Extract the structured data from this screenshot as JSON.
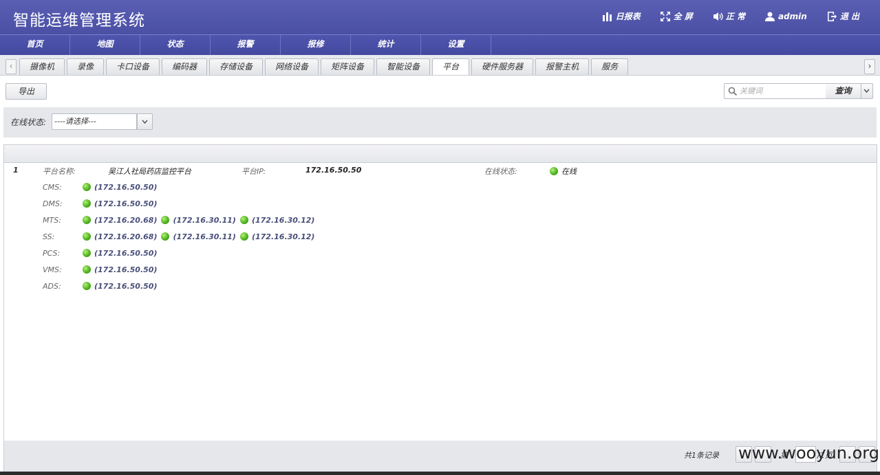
{
  "header": {
    "title": "智能运维管理系统",
    "tools": [
      {
        "icon": "bar-chart-icon",
        "label": "日报表"
      },
      {
        "icon": "fullscreen-icon",
        "label": "全 屏"
      },
      {
        "icon": "volume-icon",
        "label": "正 常"
      },
      {
        "icon": "user-icon",
        "label": "admin"
      },
      {
        "icon": "logout-icon",
        "label": "退 出"
      }
    ]
  },
  "mainnav": [
    "首页",
    "地图",
    "状态",
    "报警",
    "报修",
    "统计",
    "设置"
  ],
  "tabs": [
    {
      "label": "摄像机",
      "active": false
    },
    {
      "label": "录像",
      "active": false
    },
    {
      "label": "卡口设备",
      "active": false
    },
    {
      "label": "编码器",
      "active": false
    },
    {
      "label": "存储设备",
      "active": false
    },
    {
      "label": "网络设备",
      "active": false
    },
    {
      "label": "矩阵设备",
      "active": false
    },
    {
      "label": "智能设备",
      "active": false
    },
    {
      "label": "平台",
      "active": true
    },
    {
      "label": "硬件服务器",
      "active": false
    },
    {
      "label": "报警主机",
      "active": false
    },
    {
      "label": "服务",
      "active": false
    }
  ],
  "toolbar": {
    "export_label": "导出",
    "search_placeholder": "关键词",
    "query_label": "查询"
  },
  "filter": {
    "label": "在线状态:",
    "selected": "----请选择---"
  },
  "record": {
    "index": "1",
    "platform_name_label": "平台名称:",
    "platform_name": "吴江人社局药店监控平台",
    "platform_ip_label": "平台IP:",
    "platform_ip": "172.16.50.50",
    "online_label": "在线状态:",
    "online_value": "在线",
    "status_color": "#4fb31f",
    "services": [
      {
        "name": "CMS:",
        "ips": [
          "(172.16.50.50)"
        ]
      },
      {
        "name": "DMS:",
        "ips": [
          "(172.16.50.50)"
        ]
      },
      {
        "name": "MTS:",
        "ips": [
          "(172.16.20.68)",
          "(172.16.30.11)",
          "(172.16.30.12)"
        ]
      },
      {
        "name": "SS:",
        "ips": [
          "(172.16.20.68)",
          "(172.16.30.11)",
          "(172.16.30.12)"
        ]
      },
      {
        "name": "PCS:",
        "ips": [
          "(172.16.50.50)"
        ]
      },
      {
        "name": "VMS:",
        "ips": [
          "(172.16.50.50)"
        ]
      },
      {
        "name": "ADS:",
        "ips": [
          "(172.16.50.50)"
        ]
      }
    ]
  },
  "pager": {
    "total_text": "共1条记录",
    "page_prefix": "第",
    "page_suffix": "/1页"
  },
  "watermark": "www.wooyun.org",
  "colors": {
    "header_bg": "#5a5fb3",
    "nav_bg": "#4f55ad"
  }
}
